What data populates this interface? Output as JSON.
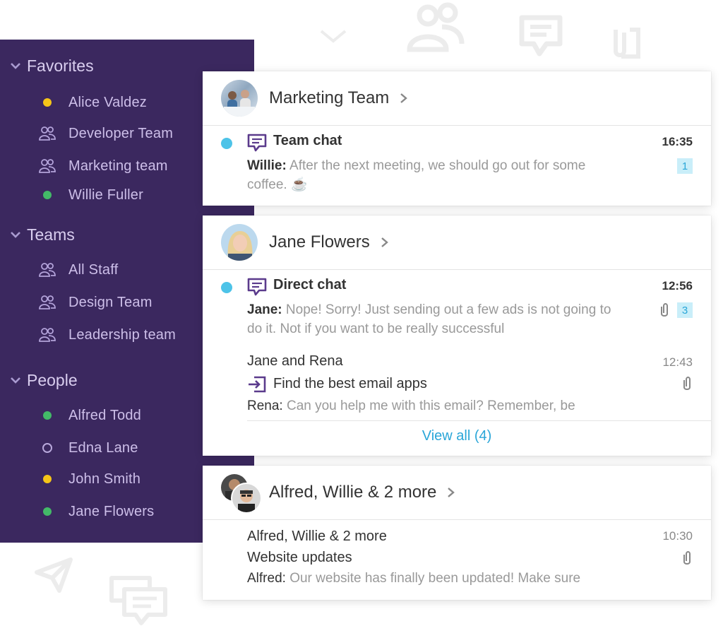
{
  "sidebar": {
    "sections": [
      {
        "label": "Favorites",
        "items": [
          {
            "label": "Alice Valdez",
            "status": "yellow"
          },
          {
            "label": "Developer Team",
            "status": "team"
          },
          {
            "label": "Marketing team",
            "status": "team"
          },
          {
            "label": "Willie Fuller",
            "status": "green"
          }
        ]
      },
      {
        "label": "Teams",
        "items": [
          {
            "label": "All Staff",
            "status": "team"
          },
          {
            "label": "Design Team",
            "status": "team"
          },
          {
            "label": "Leadership team",
            "status": "team"
          }
        ]
      },
      {
        "label": "People",
        "items": [
          {
            "label": "Alfred Todd",
            "status": "green"
          },
          {
            "label": "Edna Lane",
            "status": "empty"
          },
          {
            "label": "John Smith",
            "status": "yellow"
          },
          {
            "label": "Jane Flowers",
            "status": "green"
          }
        ]
      }
    ]
  },
  "cards": [
    {
      "title": "Marketing Team",
      "rows": [
        {
          "title": "Team chat",
          "time": "16:35",
          "sender": "Willie:",
          "message": "After the next meeting, we should go out for some coffee. ☕",
          "badge": "1"
        }
      ]
    },
    {
      "title": "Jane Flowers",
      "rows": [
        {
          "title": "Direct chat",
          "time": "12:56",
          "sender": "Jane:",
          "message": "Nope! Sorry! Just sending out a few ads is not going to do it. Not if you want to be really successful",
          "badge": "3"
        },
        {
          "participants": "Jane and Rena",
          "time": "12:43",
          "subject": "Find the best email apps",
          "sender": "Rena:",
          "message": "Can you help me with this email? Remember, be"
        }
      ],
      "view_all": "View all (4)"
    },
    {
      "title": "Alfred, Willie & 2 more",
      "rows": [
        {
          "participants": "Alfred, Willie & 2 more",
          "time": "10:30",
          "subject": "Website updates",
          "sender": "Alfred:",
          "message": "Our website has finally been updated! Make sure"
        }
      ]
    }
  ],
  "colors": {
    "sidebar_bg": "#3b285f",
    "accent": "#2aa6d8",
    "unread": "#4dc3e8",
    "chat_icon": "#5b3b8c"
  }
}
